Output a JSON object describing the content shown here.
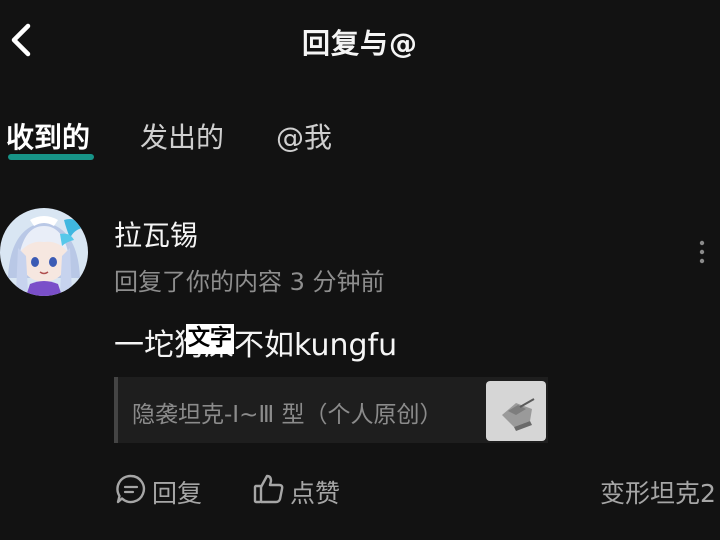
{
  "header": {
    "title": "回复与@",
    "back_icon": "chevron-left-icon"
  },
  "tabs": [
    {
      "label": "收到的",
      "active": true
    },
    {
      "label": "发出的",
      "active": false
    },
    {
      "label": "@我",
      "active": false
    }
  ],
  "colors": {
    "background": "#121212",
    "accent": "#19c0b0",
    "secondary_text": "#8e8e8e"
  },
  "notification": {
    "username": "拉瓦锡",
    "meta": "回复了你的内容 3 分钟前",
    "comment": "一坨狗屎不如kungfu",
    "overlay_label": "文字",
    "quoted": {
      "text": "隐袭坦克-Ⅰ~Ⅲ 型（个人原创）",
      "thumbnail_icon": "tank-model-thumbnail"
    },
    "actions": {
      "reply_label": "回复",
      "like_label": "点赞"
    },
    "source_label": "变形坦克2"
  }
}
